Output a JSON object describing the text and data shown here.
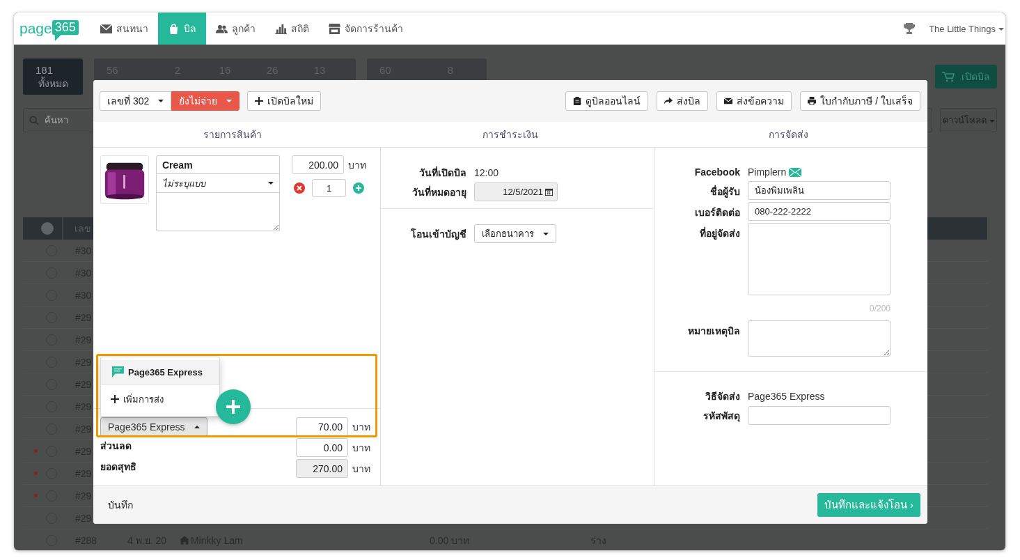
{
  "nav": {
    "logo": {
      "text": "page",
      "badge": "365"
    },
    "items": [
      {
        "label": "สนทนา",
        "selected": false
      },
      {
        "label": "บิล",
        "selected": true
      },
      {
        "label": "ลูกค้า",
        "selected": false
      },
      {
        "label": "สถิติ",
        "selected": false
      },
      {
        "label": "จัดการร้านค้า",
        "selected": false
      }
    ],
    "user": "The Little Things"
  },
  "background": {
    "tiles": [
      {
        "counts": [
          "181"
        ],
        "label": "ทั้งหมด",
        "selected": true
      },
      {
        "counts": [
          "56",
          "2",
          "16",
          "26",
          "13"
        ],
        "selected": false
      },
      {
        "counts": [
          "60",
          "8"
        ],
        "selected": false
      }
    ],
    "open_bill_button": "เปิดบิล",
    "search": {
      "placeholder": "ค้นหา"
    },
    "download_button": "ดาวน์โหลด",
    "table": {
      "columns": [
        "เลข"
      ],
      "select_all_checked": false,
      "rows": [
        {
          "code": "#30",
          "flagged": false,
          "checked": false
        },
        {
          "code": "#30",
          "flagged": false,
          "checked": false
        },
        {
          "code": "#30",
          "flagged": false,
          "checked": false
        },
        {
          "code": "#29",
          "flagged": false,
          "checked": false
        },
        {
          "code": "#29",
          "flagged": false,
          "checked": false
        },
        {
          "code": "#29",
          "flagged": false,
          "checked": false
        },
        {
          "code": "#29",
          "flagged": false,
          "checked": false
        },
        {
          "code": "#29",
          "flagged": false,
          "checked": false
        },
        {
          "code": "#29",
          "flagged": false,
          "checked": false
        },
        {
          "code": "#29",
          "flagged": true,
          "checked": false
        },
        {
          "code": "#29",
          "flagged": true,
          "checked": false
        },
        {
          "code": "#29",
          "flagged": true,
          "checked": false
        },
        {
          "code": "#29",
          "flagged": false,
          "checked": false
        }
      ],
      "last_row": {
        "checked": false,
        "code": "#288",
        "date": "4 พ.ย. 20",
        "customer": "Minkky Lam",
        "amount": "0.00 บาท",
        "status": "ร่าง"
      }
    }
  },
  "modal": {
    "bill_number": "เลขที่ 302",
    "status": {
      "label": "ยังไม่จ่าย",
      "paid": false
    },
    "new_bill_button": "เปิดบิลใหม่",
    "actions": [
      "ดูบิลออนไลน์",
      "ส่งบิล",
      "ส่งข้อความ",
      "ใบกำกับภาษี / ใบเสร็จ"
    ],
    "sections": [
      "รายการสินค้า",
      "การชำระเงิน",
      "การจัดส่ง"
    ],
    "items": [
      {
        "name": "Cream",
        "variant": "ไม่ระบุแบบ",
        "price": "200.00",
        "unit": "บาท",
        "quantity": "1"
      }
    ],
    "shipping_menu": {
      "options": [
        {
          "label": "Page365 Express",
          "selected": true
        }
      ],
      "add_option": "เพิ่มการส่ง"
    },
    "shipping": {
      "method": "Page365 Express",
      "expanded": true,
      "fee": "70.00",
      "unit": "บาท"
    },
    "discount": {
      "label": "ส่วนลด",
      "value": "0.00",
      "unit": "บาท"
    },
    "total": {
      "label": "ยอดสุทธิ",
      "value": "270.00",
      "unit": "บาท"
    },
    "payment": {
      "open_date": {
        "label": "วันที่เปิดบิล",
        "value": "12:00"
      },
      "expiry": {
        "label": "วันที่หมดอายุ",
        "value": "12/5/2021"
      },
      "transfer": {
        "label": "โอนเข้าบัญชี",
        "value": "เลือกธนาคาร"
      }
    },
    "delivery": {
      "facebook": {
        "label": "Facebook",
        "value": "Pimplern"
      },
      "fields": [
        {
          "kind": "input",
          "label": "ชื่อผู้รับ",
          "value": "น้องพิมเพลิน"
        },
        {
          "kind": "input",
          "label": "เบอร์ติดต่อ",
          "value": "080-222-2222"
        },
        {
          "kind": "textarea",
          "label": "ที่อยู่จัดส่ง",
          "counter": "0/200"
        },
        {
          "kind": "note",
          "label": "หมายเหตุบิล"
        }
      ],
      "method": {
        "label": "วิธีจัดส่ง",
        "value": "Page365 Express"
      },
      "tracking": {
        "label": "รหัสพัสดุ"
      }
    },
    "footer": {
      "save": "บันทึก",
      "submit": "บันทึกและแจ้งโอน ›"
    }
  }
}
